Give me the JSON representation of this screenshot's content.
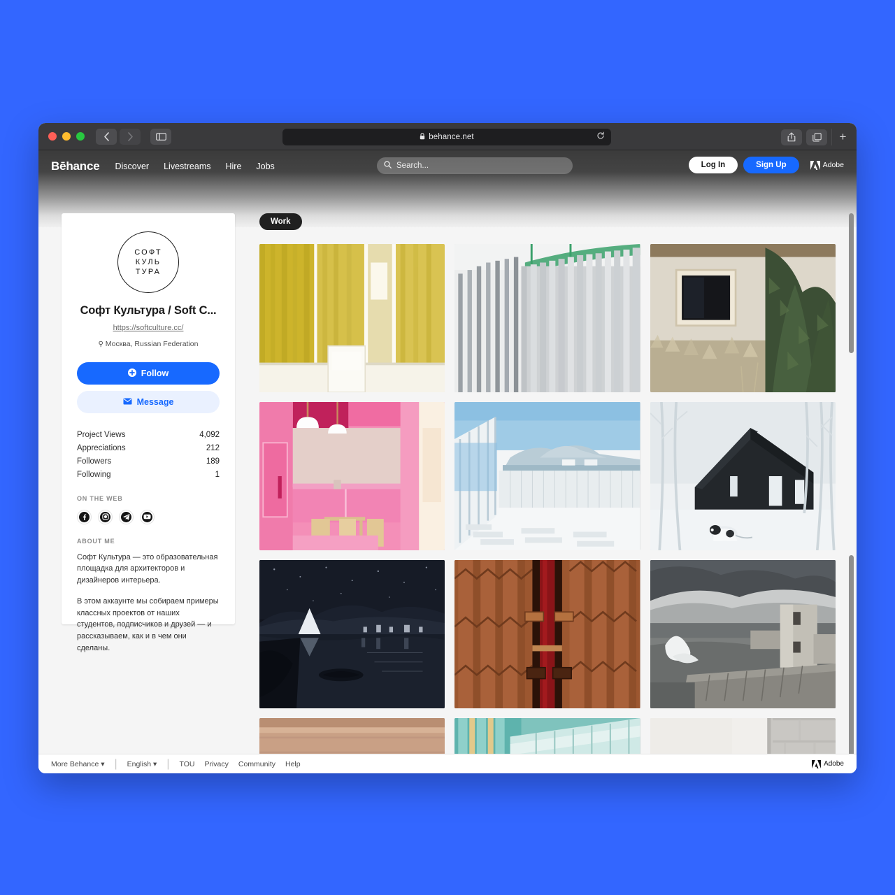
{
  "desktop": {
    "background_color": "#3366ff"
  },
  "browser": {
    "traffic_lights": [
      "close",
      "minimize",
      "zoom"
    ],
    "back_label": "‹",
    "forward_label": "›",
    "url": "behance.net",
    "lock_icon": "lock-icon",
    "reload_icon": "reload-icon",
    "share_icon": "share-icon",
    "tabs_icon": "tab-overview-icon",
    "new_tab_label": "+"
  },
  "site_header": {
    "logo": "Bēhance",
    "nav": [
      {
        "label": "Discover"
      },
      {
        "label": "Livestreams"
      },
      {
        "label": "Hire"
      },
      {
        "label": "Jobs"
      }
    ],
    "search_placeholder": "Search...",
    "login_label": "Log In",
    "signup_label": "Sign Up",
    "adobe_label": "Adobe",
    "accent_color": "#1769ff"
  },
  "profile": {
    "avatar_lines": [
      "СОФТ",
      "КУЛЬ",
      "ТУРА"
    ],
    "name": "Софт Культура / Soft C...",
    "url": "https://softculture.cc/",
    "location": "Москва, Russian Federation",
    "follow_label": "Follow",
    "message_label": "Message",
    "stats": [
      {
        "label": "Project Views",
        "value": "4,092"
      },
      {
        "label": "Appreciations",
        "value": "212"
      },
      {
        "label": "Followers",
        "value": "189"
      },
      {
        "label": "Following",
        "value": "1"
      }
    ],
    "on_the_web_title": "ON THE WEB",
    "socials": [
      {
        "name": "facebook-icon"
      },
      {
        "name": "instagram-icon"
      },
      {
        "name": "telegram-icon"
      },
      {
        "name": "youtube-icon"
      }
    ],
    "about_title": "ABOUT ME",
    "about_paragraphs": [
      "Софт Культура — это образовательная площадка для архитекторов и дизайнеров интерьера.",
      "В этом аккаунте мы собираем примеры классных проектов от наших студентов, подписчиков и друзей — и рассказываем, как и в чем они сделаны."
    ]
  },
  "main": {
    "tab_label": "Work",
    "projects": [
      {
        "name": "yellow-curtain-interior"
      },
      {
        "name": "grey-curtain-columns"
      },
      {
        "name": "cabin-window-spruce"
      },
      {
        "name": "pink-kitchen-interior"
      },
      {
        "name": "white-terrace-sea-view"
      },
      {
        "name": "black-cabin-snow-dog"
      },
      {
        "name": "night-lake-dam"
      },
      {
        "name": "wooden-red-door-detail"
      },
      {
        "name": "storm-concrete-tower"
      },
      {
        "name": "brick-facade-arched-windows"
      },
      {
        "name": "teal-glass-canopy"
      },
      {
        "name": "white-concrete-wall"
      }
    ]
  },
  "footer": {
    "more_behance": "More Behance",
    "language": "English",
    "links": [
      "TOU",
      "Privacy",
      "Community",
      "Help"
    ],
    "adobe_label": "Adobe"
  }
}
